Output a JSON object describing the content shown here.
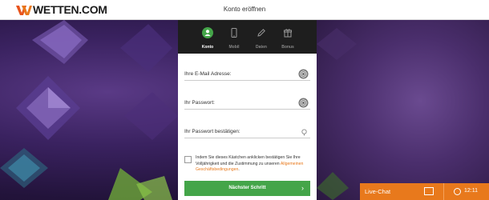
{
  "header": {
    "logo_text": "WETTEN.COM",
    "page_title": "Konto eröffnen"
  },
  "steps": [
    {
      "label": "Konto",
      "icon": "user-icon",
      "active": true
    },
    {
      "label": "Mobil",
      "icon": "phone-icon",
      "active": false
    },
    {
      "label": "Daten",
      "icon": "pencil-icon",
      "active": false
    },
    {
      "label": "Bonus",
      "icon": "gift-icon",
      "active": false
    }
  ],
  "form": {
    "email_label": "Ihre E-Mail Adresse:",
    "password_label": "Ihr Passwort:",
    "password_confirm_label": "Ihr Passwort bestätigen:",
    "terms_text": "Indem Sie dieses Kästchen anklicken bestätigen Sie Ihre Volljährigkeit und die Zustimmung zu unseren",
    "terms_link": "Allgemeinen Geschäftsbedingungen",
    "terms_suffix": ".",
    "next_button": "Nächster Schritt",
    "next_arrow": "›"
  },
  "footer": {
    "live_chat_label": "Live-Chat",
    "clock_time": "12:11"
  },
  "colors": {
    "accent_orange": "#e8791c",
    "button_green": "#44a549",
    "step_bar": "#1e1e1e",
    "active_step": "#44a549"
  }
}
